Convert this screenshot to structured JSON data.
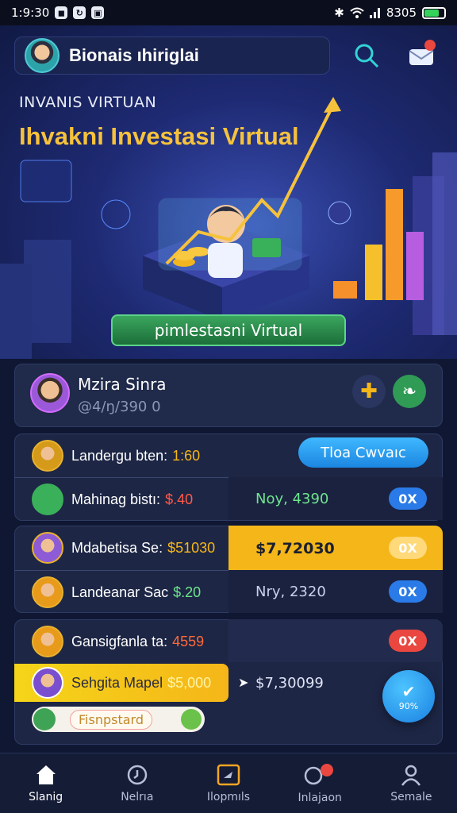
{
  "statusbar": {
    "time": "1:9:30",
    "battery_text": "8305"
  },
  "header": {
    "profile_name": "Bionais ıhiriglai"
  },
  "hero": {
    "subtitle": "INVANIS VIRTUAN",
    "title": "Ihvakni Investasi Virtual",
    "cta_label": "pimlestasni Virtual"
  },
  "user": {
    "name": "Mzira Sinra",
    "balance": "@4/ŋ/390 0"
  },
  "rows": [
    {
      "label": "Landergu bten:",
      "value": "1:60",
      "action": "Tloa Cwvaıc"
    },
    {
      "label": "Mahinag bistı:",
      "value": "$.40",
      "amount": "Noy, 4390",
      "pct": "0X"
    },
    {
      "label": "Mdabetisa Se:",
      "value": "$51030",
      "amount": "$7,72030",
      "pct": "0X"
    },
    {
      "label": "Landeanar Sac",
      "value": "$.20",
      "amount": "Nry, 2320",
      "pct": "0X"
    },
    {
      "label": "Gansigfanla ta:",
      "value": "4559",
      "pct": "0X"
    },
    {
      "label": "Sehgita Mapel",
      "value": "$5,000",
      "amount": "$7,30099"
    },
    {
      "label": "Fisnpstard"
    }
  ],
  "fab": {
    "label": "90%"
  },
  "nav": [
    {
      "label": "Slanig"
    },
    {
      "label": "Nelrıa"
    },
    {
      "label": "Ilopmıls"
    },
    {
      "label": "Inlajaon"
    },
    {
      "label": "Semale"
    }
  ],
  "colors": {
    "accent_green": "#36b865",
    "accent_blue": "#2a9df4",
    "accent_yellow": "#f5b619",
    "alert_red": "#e9473f"
  }
}
